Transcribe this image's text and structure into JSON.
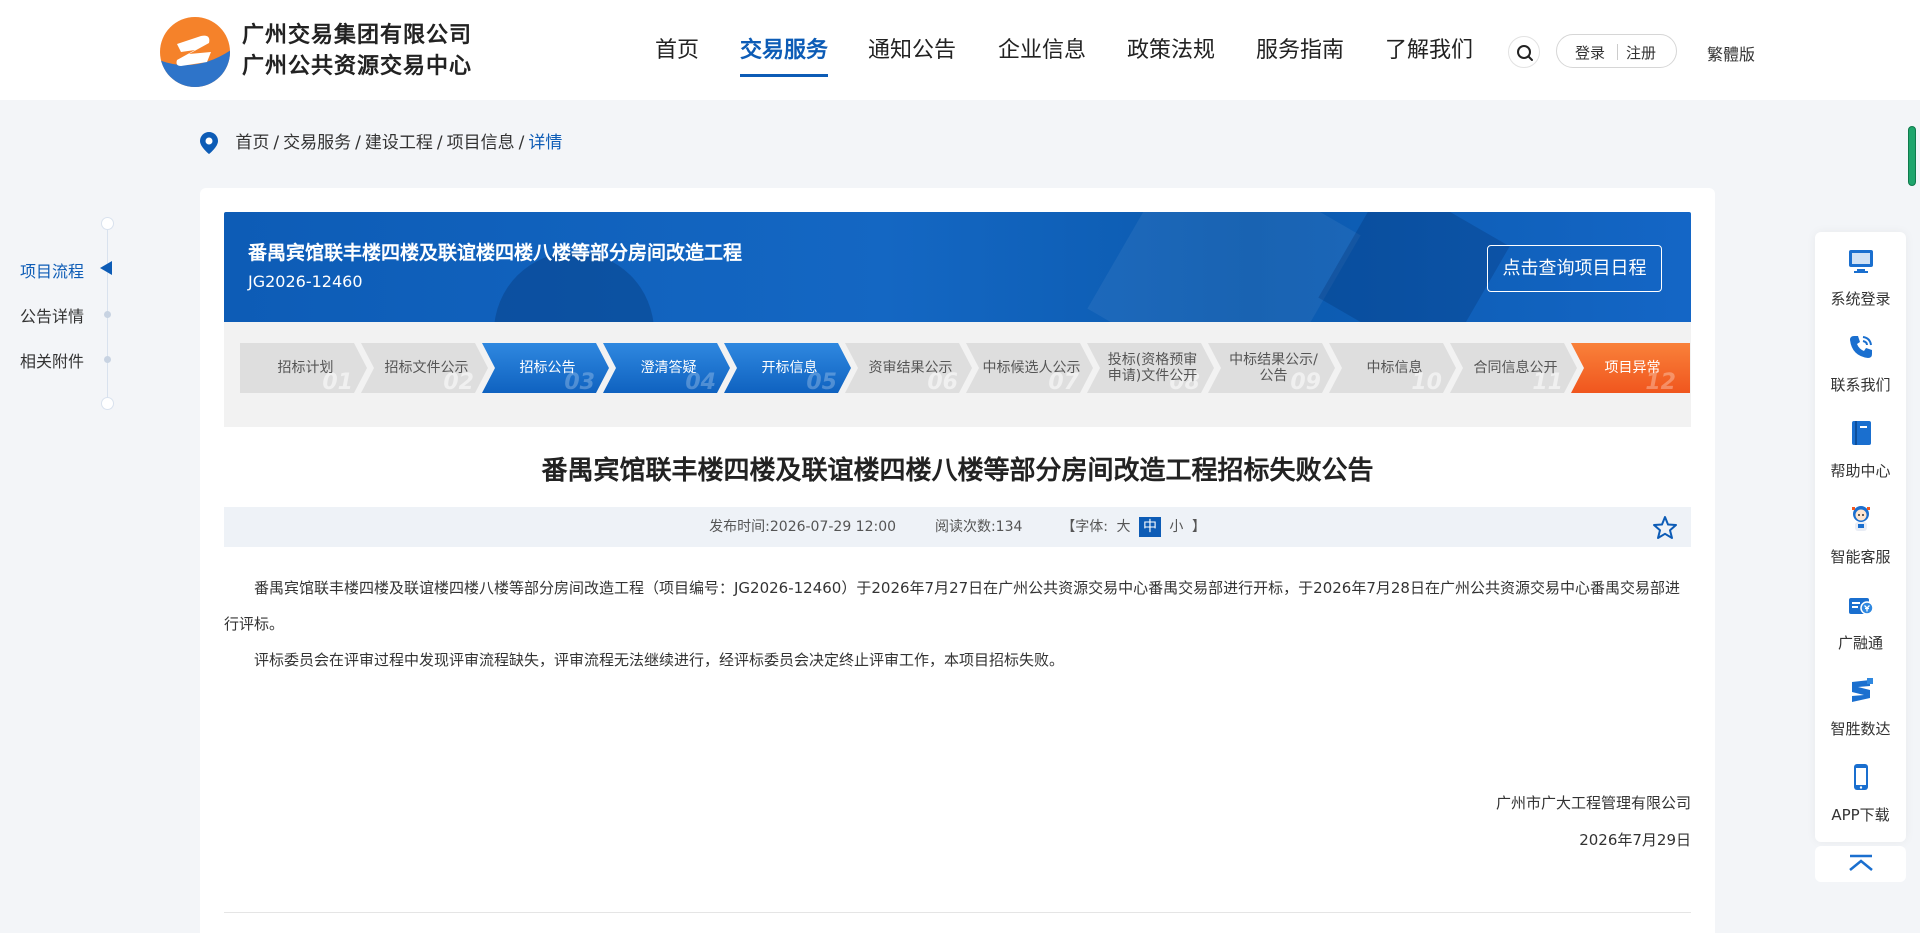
{
  "header": {
    "logo_line1": "广州交易集团有限公司",
    "logo_line2": "广州公共资源交易中心",
    "nav": [
      {
        "label": "首页"
      },
      {
        "label": "交易服务"
      },
      {
        "label": "通知公告"
      },
      {
        "label": "企业信息"
      },
      {
        "label": "政策法规"
      },
      {
        "label": "服务指南"
      },
      {
        "label": "了解我们"
      }
    ],
    "active_nav": "交易服务",
    "search_icon": "search-icon",
    "login": "登录",
    "register": "注册",
    "lang": "繁體版"
  },
  "breadcrumb": {
    "items": [
      "首页",
      "交易服务",
      "建设工程",
      "项目信息"
    ],
    "current": "详情",
    "separator": "/"
  },
  "left_nav": {
    "items": [
      "项目流程",
      "公告详情",
      "相关附件"
    ],
    "active": "项目流程"
  },
  "project": {
    "title": "番禺宾馆联丰楼四楼及联谊楼四楼八楼等部分房间改造工程",
    "code": "JG2026-12460",
    "schedule_button": "点击查询项目日程"
  },
  "steps": [
    {
      "label": "招标计划",
      "num": "01",
      "state": "gray"
    },
    {
      "label": "招标文件公示",
      "num": "02",
      "state": "gray"
    },
    {
      "label": "招标公告",
      "num": "03",
      "state": "blue"
    },
    {
      "label": "澄清答疑",
      "num": "04",
      "state": "blue"
    },
    {
      "label": "开标信息",
      "num": "05",
      "state": "blue"
    },
    {
      "label": "资审结果公示",
      "num": "06",
      "state": "gray"
    },
    {
      "label": "中标候选人公示",
      "num": "07",
      "state": "gray"
    },
    {
      "label": "投标(资格预审申请)文件公开",
      "num": "08",
      "state": "gray"
    },
    {
      "label": "中标结果公示/公告",
      "num": "09",
      "state": "gray"
    },
    {
      "label": "中标信息",
      "num": "10",
      "state": "gray"
    },
    {
      "label": "合同信息公开",
      "num": "11",
      "state": "gray"
    },
    {
      "label": "项目异常",
      "num": "12",
      "state": "orange"
    }
  ],
  "article": {
    "title": "番禺宾馆联丰楼四楼及联谊楼四楼八楼等部分房间改造工程招标失败公告",
    "publish_label": "发布时间:",
    "publish_time": "2026-07-29 12:00",
    "read_label": "阅读次数:",
    "read_count": "134",
    "font_prefix": "【字体:",
    "font_large": "大",
    "font_medium": "中",
    "font_small": "小",
    "font_suffix": "】",
    "active_font": "中",
    "paragraph1": "番禺宾馆联丰楼四楼及联谊楼四楼八楼等部分房间改造工程（项目编号：JG2026-12460）于2026年7月27日在广州公共资源交易中心番禺交易部进行开标，于2026年7月28日在广州公共资源交易中心番禺交易部进行评标。",
    "paragraph2": "评标委员会在评审过程中发现评审流程缺失，评审流程无法继续进行，经评标委员会决定终止评审工作，本项目招标失败。",
    "signer": "广州市广大工程管理有限公司",
    "sign_date": "2026年7月29日"
  },
  "right_bar": {
    "items": [
      {
        "label": "系统登录",
        "icon": "monitor-icon"
      },
      {
        "label": "联系我们",
        "icon": "phone-icon"
      },
      {
        "label": "帮助中心",
        "icon": "book-icon"
      },
      {
        "label": "智能客服",
        "icon": "robot-icon"
      },
      {
        "label": "广融通",
        "icon": "finance-icon"
      },
      {
        "label": "智胜数达",
        "icon": "data-icon"
      },
      {
        "label": "APP下载",
        "icon": "mobile-icon"
      }
    ],
    "to_top_icon": "chevron-up-icon"
  },
  "colors": {
    "primary": "#0d5cb6",
    "step_active": "#1a6fcf",
    "step_abnormal": "#f0561e",
    "logo_orange": "#f5822a"
  }
}
